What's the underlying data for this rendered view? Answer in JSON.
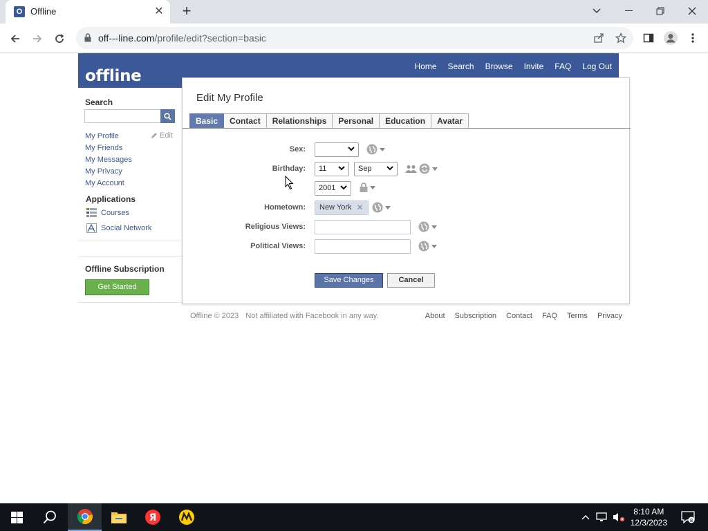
{
  "browser": {
    "tab_title": "Offline",
    "favicon_letter": "O",
    "url_host": "off---line.com",
    "url_path": "/profile/edit?section=basic"
  },
  "site": {
    "logo": "offline",
    "topnav": [
      "Home",
      "Search",
      "Browse",
      "Invite",
      "FAQ",
      "Log Out"
    ]
  },
  "sidebar": {
    "search_label": "Search",
    "links": [
      "My Profile",
      "My Friends",
      "My Messages",
      "My Privacy",
      "My Account"
    ],
    "edit_label": "Edit",
    "apps_title": "Applications",
    "apps": [
      "Courses",
      "Social Network"
    ],
    "subscription_title": "Offline Subscription",
    "subscription_button": "Get Started"
  },
  "dialog": {
    "title": "Edit My Profile",
    "tabs": [
      "Basic",
      "Contact",
      "Relationships",
      "Personal",
      "Education",
      "Avatar"
    ],
    "active_tab": "Basic",
    "fields": {
      "sex_label": "Sex:",
      "sex_value": "",
      "birthday_label": "Birthday:",
      "birthday_day": "11",
      "birthday_month": "Sep",
      "birthday_year": "2001",
      "hometown_label": "Hometown:",
      "hometown_token": "New York",
      "religious_label": "Religious Views:",
      "religious_value": "",
      "political_label": "Political Views:",
      "political_value": ""
    },
    "save_button": "Save Changes",
    "cancel_button": "Cancel"
  },
  "footer": {
    "copyright": "Offline © 2023",
    "disclaimer": "Not affiliated with Facebook in any way.",
    "links": [
      "About",
      "Subscription",
      "Contact",
      "FAQ",
      "Terms",
      "Privacy"
    ]
  },
  "taskbar": {
    "time": "8:10 AM",
    "date": "12/3/2023",
    "notification_count": "8"
  },
  "colors": {
    "brand": "#3b5998",
    "tab_active": "#627aad",
    "button_primary": "#5b74a8",
    "button_green": "#6ab04c"
  }
}
